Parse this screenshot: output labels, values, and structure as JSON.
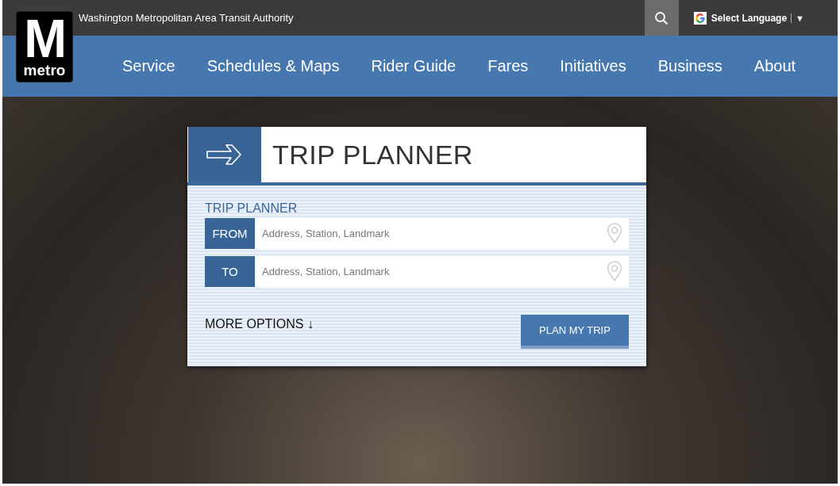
{
  "header": {
    "logo": {
      "letter": "M",
      "wordmark": "metro"
    },
    "agency_name": "Washington Metropolitan Area Transit Authority",
    "language_selector": {
      "label": "Select Language",
      "caret": "▼"
    }
  },
  "nav": [
    {
      "label": "Service"
    },
    {
      "label": "Schedules & Maps"
    },
    {
      "label": "Rider Guide"
    },
    {
      "label": "Fares"
    },
    {
      "label": "Initiatives"
    },
    {
      "label": "Business"
    },
    {
      "label": "About"
    }
  ],
  "trip_planner": {
    "title": "TRIP PLANNER",
    "subtitle": "TRIP PLANNER",
    "fields": [
      {
        "label": "FROM",
        "placeholder": "Address, Station, Landmark"
      },
      {
        "label": "TO",
        "placeholder": "Address, Station, Landmark"
      }
    ],
    "more_options": "MORE OPTIONS ↓",
    "submit": "PLAN MY TRIP"
  }
}
